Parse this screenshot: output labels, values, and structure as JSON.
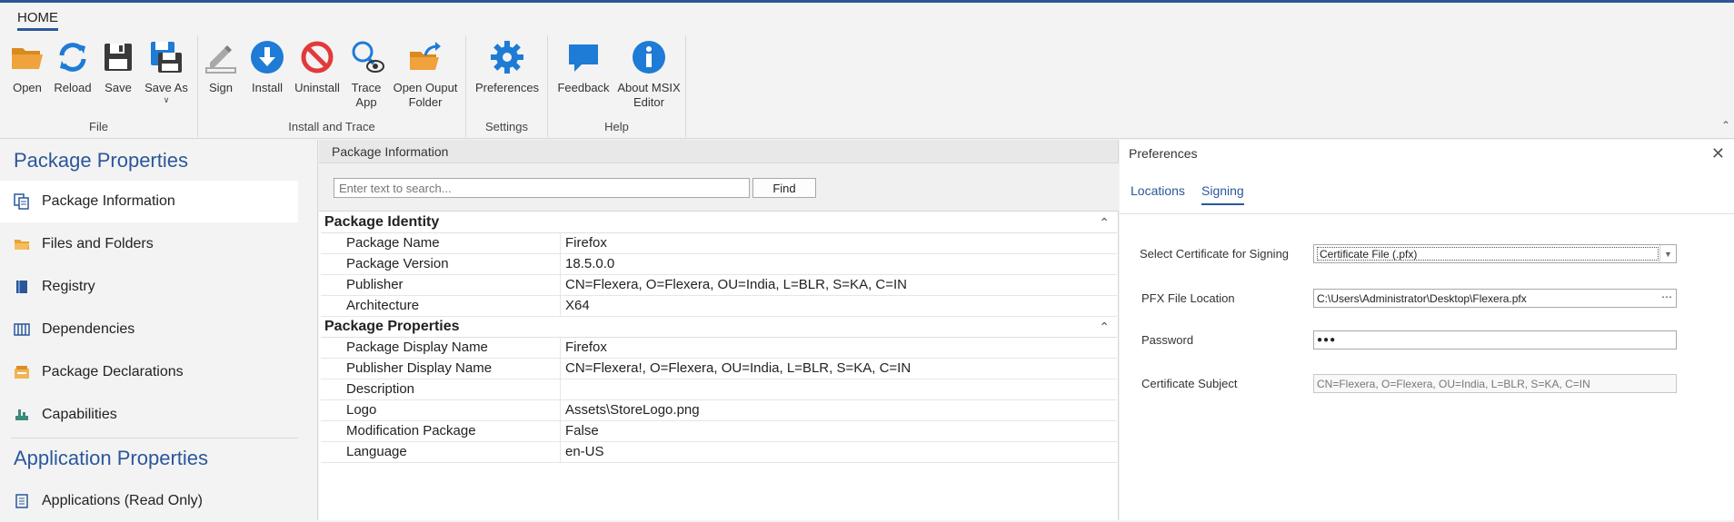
{
  "ribbon": {
    "tab": "HOME",
    "groups": {
      "file": "File",
      "install_trace": "Install and Trace",
      "settings": "Settings",
      "help": "Help"
    },
    "buttons": {
      "open": "Open",
      "reload": "Reload",
      "save": "Save",
      "save_as": "Save As",
      "sign": "Sign",
      "install": "Install",
      "uninstall": "Uninstall",
      "trace_1": "Trace",
      "trace_2": "App",
      "open_output_1": "Open Ouput",
      "open_output_2": "Folder",
      "preferences": "Preferences",
      "feedback": "Feedback",
      "about_1": "About MSIX",
      "about_2": "Editor"
    },
    "colors": {
      "accent": "#2b579a",
      "icon_blue": "#1e7bd6",
      "uninstall_red": "#e23a3a",
      "folder_orange": "#f0a23c"
    }
  },
  "left": {
    "package_properties": "Package Properties",
    "items": [
      {
        "label": "Package Information",
        "icon": "package-info-icon"
      },
      {
        "label": "Files and Folders",
        "icon": "folder-icon"
      },
      {
        "label": "Registry",
        "icon": "registry-icon"
      },
      {
        "label": "Dependencies",
        "icon": "dependencies-icon"
      },
      {
        "label": "Package Declarations",
        "icon": "declarations-icon"
      },
      {
        "label": "Capabilities",
        "icon": "capabilities-icon"
      }
    ],
    "application_properties": "Application Properties",
    "app_items": [
      {
        "label": "Applications (Read Only)",
        "icon": "applications-icon"
      }
    ]
  },
  "center": {
    "header": "Package Information",
    "search_placeholder": "Enter text to search...",
    "find": "Find",
    "identity_group": "Package Identity",
    "identity": [
      {
        "k": "Package Name",
        "v": "Firefox"
      },
      {
        "k": "Package Version",
        "v": "18.5.0.0"
      },
      {
        "k": "Publisher",
        "v": "CN=Flexera, O=Flexera, OU=India, L=BLR, S=KA, C=IN"
      },
      {
        "k": "Architecture",
        "v": "X64"
      }
    ],
    "properties_group": "Package Properties",
    "properties": [
      {
        "k": "Package Display Name",
        "v": "Firefox"
      },
      {
        "k": "Publisher Display Name",
        "v": "CN=Flexera!, O=Flexera, OU=India, L=BLR, S=KA, C=IN"
      },
      {
        "k": "Description",
        "v": ""
      },
      {
        "k": "Logo",
        "v": "Assets\\StoreLogo.png"
      },
      {
        "k": "Modification Package",
        "v": "False"
      },
      {
        "k": "Language",
        "v": "en-US"
      }
    ]
  },
  "right": {
    "title": "Preferences",
    "tabs": {
      "locations": "Locations",
      "signing": "Signing"
    },
    "cert_label": "Select Certificate for Signing",
    "cert_value": "Certificate File (.pfx)",
    "pfx_label": "PFX File Location",
    "pfx_value": "C:\\Users\\Administrator\\Desktop\\Flexera.pfx",
    "password_label": "Password",
    "password_value": "●●●",
    "subject_label": "Certificate Subject",
    "subject_value": "CN=Flexera, O=Flexera, OU=India, L=BLR, S=KA, C=IN"
  }
}
